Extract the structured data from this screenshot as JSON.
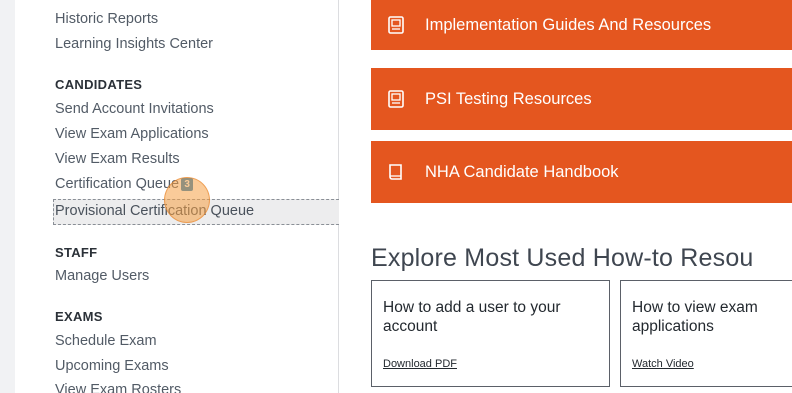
{
  "sidebar": {
    "reports_links": [
      "Historic Reports",
      "Learning Insights Center"
    ],
    "candidates_heading": "CANDIDATES",
    "candidates_links": [
      "Send Account Invitations",
      "View Exam Applications",
      "View Exam Results"
    ],
    "certification_queue": {
      "label": "Certification Queue",
      "badge": "3"
    },
    "provisional_queue": "Provisional Certification Queue",
    "staff_heading": "STAFF",
    "staff_links": [
      "Manage Users"
    ],
    "exams_heading": "EXAMS",
    "exams_links": [
      "Schedule Exam",
      "Upcoming Exams",
      "View Exam Rosters"
    ]
  },
  "main": {
    "resources": [
      {
        "label": "Implementation Guides And Resources",
        "icon": "document-icon"
      },
      {
        "label": "PSI Testing Resources",
        "icon": "document-icon"
      },
      {
        "label": "NHA Candidate Handbook",
        "icon": "book-icon"
      }
    ],
    "explore_heading": "Explore Most Used How-to Resou",
    "cards": [
      {
        "title": "How to add a user to your account",
        "link": "Download PDF"
      },
      {
        "title": "How to view exam applications",
        "link": "Watch Video"
      }
    ]
  },
  "colors": {
    "accent": "#e4561f",
    "badge": "#1f7fc0",
    "highlight": "#f5a046"
  }
}
